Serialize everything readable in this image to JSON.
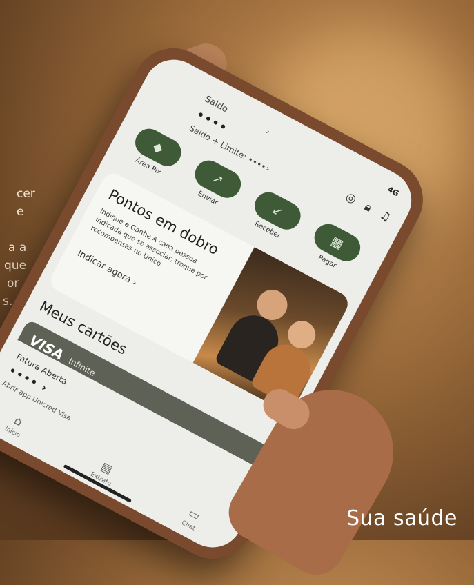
{
  "background_text": {
    "left_lines": [
      "cer",
      "e",
      "a a",
      "que",
      "or",
      "s."
    ],
    "corner": "Sua saúde"
  },
  "phone": {
    "status": "4G",
    "saldo_label": "Saldo",
    "saldo_value": "••••",
    "limite_label": "Saldo + Limite: ••••",
    "actions": [
      {
        "label": "Área Pix",
        "icon": "pix-icon"
      },
      {
        "label": "Enviar",
        "icon": "send-icon"
      },
      {
        "label": "Receber",
        "icon": "receive-icon"
      },
      {
        "label": "Pagar",
        "icon": "barcode-icon"
      }
    ],
    "promo": {
      "title": "Pontos em dobro",
      "subtitle": "Indique e Ganhe A cada pessoa indicada que se associar, troque por recompensas no Unico",
      "link": "Indicar agora ›"
    },
    "cards_title": "Meus cartões",
    "card": {
      "brand": "VISA",
      "tier": "Infinite",
      "fatura_label": "Fatura Aberta",
      "fatura_value": "•••• ›",
      "open_app": "Abrir app Unicred Visa"
    },
    "tabs": [
      {
        "label": "Início",
        "icon": "home-icon"
      },
      {
        "label": "Extrato",
        "icon": "statement-icon"
      },
      {
        "label": "Chat",
        "icon": "chat-icon"
      }
    ]
  }
}
